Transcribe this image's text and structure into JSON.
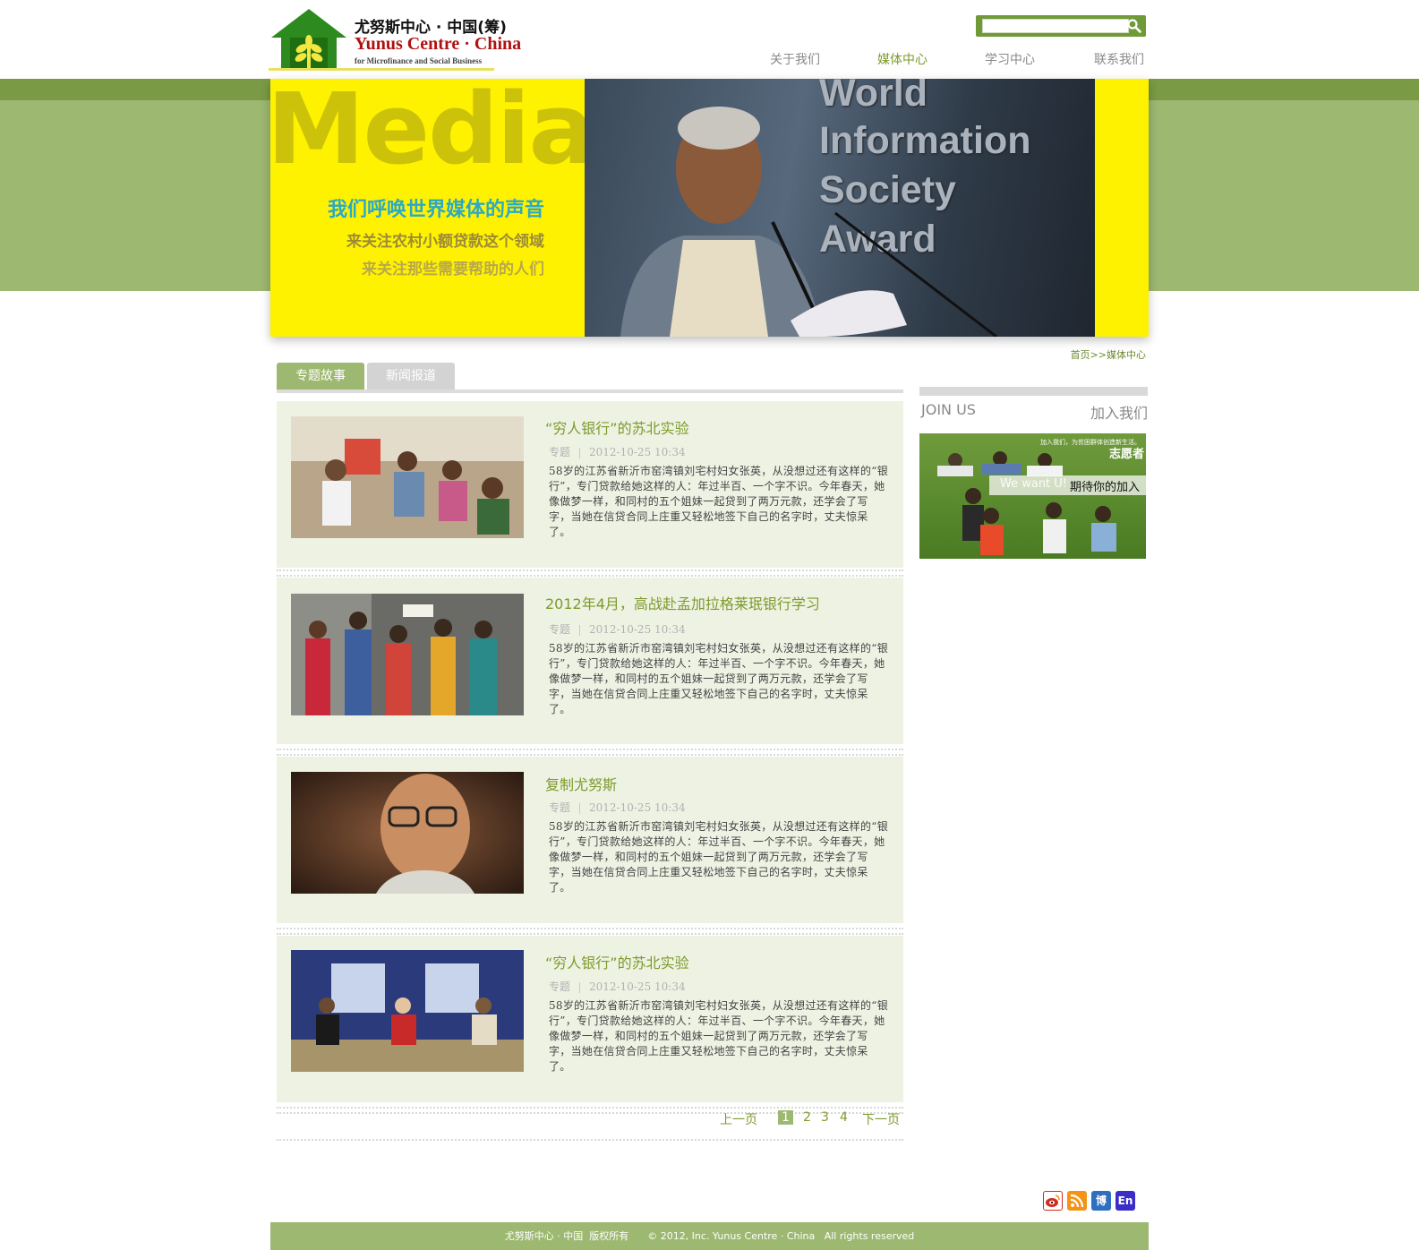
{
  "header": {
    "logo": {
      "cn": "尤努斯中心 · 中国(筹)",
      "en": "Yunus Centre · China",
      "sub": "for Microfinance and Social Business"
    },
    "search": {
      "value": "",
      "placeholder": ""
    },
    "nav": [
      {
        "label": "关于我们",
        "active": false
      },
      {
        "label": "媒体中心",
        "active": true
      },
      {
        "label": "学习中心",
        "active": false
      },
      {
        "label": "联系我们",
        "active": false
      }
    ]
  },
  "banner": {
    "heading": "Media",
    "slogans": [
      "我们呼唤世界媒体的声音",
      "来关注农村小额贷款这个领域",
      "来关注那些需要帮助的人们"
    ],
    "photo_text": [
      "World",
      "Information",
      "Society",
      "Award"
    ]
  },
  "breadcrumb": "首页>>媒体中心",
  "tabs": [
    {
      "label": "专题故事",
      "active": true
    },
    {
      "label": "新闻报道",
      "active": false
    }
  ],
  "articles": [
    {
      "title": "“穷人银行”的苏北实验",
      "category": "专题",
      "date": "2012-10-25 10:34",
      "body": "58岁的江苏省新沂市窑湾镇刘宅村妇女张英，从没想过还有这样的“银行”，专门贷款给她这样的人：年过半百、一个字不识。今年春天，她像做梦一样，和同村的五个姐妹一起贷到了两万元款，还学会了写字，当她在信贷合同上庄重又轻松地签下自己的名字时，丈夫惊呆了。",
      "image": "photo-villagers"
    },
    {
      "title": "2012年4月，高战赴孟加拉格莱珉银行学习",
      "category": "专题",
      "date": "2012-10-25 10:34",
      "body": "58岁的江苏省新沂市窑湾镇刘宅村妇女张英，从没想过还有这样的“银行”，专门贷款给她这样的人：年过半百、一个字不识。今年春天，她像做梦一样，和同村的五个姐妹一起贷到了两万元款，还学会了写字，当她在信贷合同上庄重又轻松地签下自己的名字时，丈夫惊呆了。",
      "image": "photo-bangladesh-visit"
    },
    {
      "title": "复制尤努斯",
      "category": "专题",
      "date": "2012-10-25 10:34",
      "body": "58岁的江苏省新沂市窑湾镇刘宅村妇女张英，从没想过还有这样的“银行”，专门贷款给她这样的人：年过半百、一个字不识。今年春天，她像做梦一样，和同村的五个姐妹一起贷到了两万元款，还学会了写字，当她在信贷合同上庄重又轻松地签下自己的名字时，丈夫惊呆了。",
      "image": "photo-portrait"
    },
    {
      "title": "“穷人银行”的苏北实验",
      "category": "专题",
      "date": "2012-10-25 10:34",
      "body": "58岁的江苏省新沂市窑湾镇刘宅村妇女张英，从没想过还有这样的“银行”，专门贷款给她这样的人：年过半百、一个字不识。今年春天，她像做梦一样，和同村的五个姐妹一起贷到了两万元款，还学会了写字，当她在信贷合同上庄重又轻松地签下自己的名字时，丈夫惊呆了。",
      "image": "photo-clinton-global-initiative"
    }
  ],
  "pager": {
    "prev": "上一页",
    "pages": [
      "1",
      "2",
      "3",
      "4"
    ],
    "current": "1",
    "next": "下一页"
  },
  "sidebar": {
    "join_en": "JOIN US",
    "join_cn": "加入我们",
    "image": {
      "small_text": "加入我们，为贫困群体创造新生活。",
      "title": "志愿者",
      "faded_text": "We want U!",
      "caption": "期待你的加入"
    }
  },
  "social": [
    {
      "icon": "weibo-icon",
      "color": "#d52b1e"
    },
    {
      "icon": "rss-icon",
      "color": "#f39419"
    },
    {
      "icon": "blog-icon",
      "label": "博",
      "color": "#2e6fc0"
    },
    {
      "icon": "english-icon",
      "label": "En",
      "color": "#3b2ec8"
    }
  ],
  "footer": {
    "text": "尤努斯中心 · 中国  版权所有      © 2012, Inc. Yunus Centre · China   All rights reserved"
  },
  "colors": {
    "brand_green": "#7d9b2c",
    "band_green": "#9db871",
    "banner_yellow": "#fff200",
    "article_bg": "#eef2e3"
  }
}
